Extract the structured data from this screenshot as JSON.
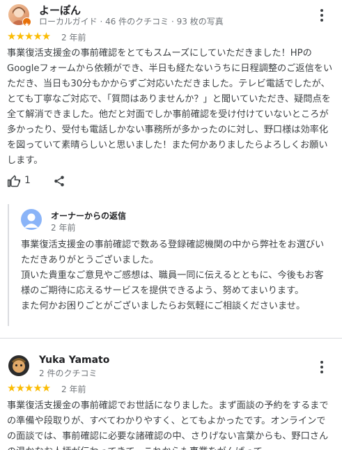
{
  "reviews": [
    {
      "author": "よーぽん",
      "meta": "ローカルガイド · 46 件のクチコミ · 93 枚の写真",
      "stars": "★★★★★",
      "rating": 5,
      "date": "2 年前",
      "text": "事業復活支援金の事前確認をとてもスムーズにしていただきました！HPのGoogleフォームから依頼ができ、半日も経たないうちに日程調整のご返信をいただき、当日も30分もかからずご対応いただきました。テレビ電話でしたが、とても丁寧なご対応で、「質問はありませんか？」と聞いていただき、疑問点を全て解消できました。他だと対面でしか事前確認を受け付けていないところが多かったり、受付も電話しかない事務所が多かったのに対し、野口様は効率化を図っていて素晴らしいと思いました！また何かありましたらよろしくお願いします。",
      "like_count": "1",
      "owner_reply": {
        "label": "オーナーからの返信",
        "date": "2 年前",
        "text": "事業復活支援金の事前確認で数ある登録確認機関の中から弊社をお選びいただきありがとうございました。\n頂いた貴重なご意見やご感想は、職員一同に伝えるとともに、今後もお客様のご期待に応えるサービスを提供できるよう、努めてまいります。\nまた何かお困りごとがございましたらお気軽にご相談くださいませ。"
      }
    },
    {
      "author": "Yuka Yamato",
      "meta": "2 件のクチコミ",
      "stars": "★★★★★",
      "rating": 5,
      "date": "2 年前",
      "text": "事業復活支援金の事前確認でお世話になりました。まず面談の予約をするまでの準備や段取りが、すべてわかりやすく、とてもよかったです。オンラインでの面談では、事前確認に必要な諸確認の中、さりげない言葉からも、野口さんの温かなお人柄が伝わってきて、これからも事業をがんばって"
    }
  ],
  "colors": {
    "star": "#fbbc04",
    "text": "#3c4043",
    "secondary": "#70757a"
  },
  "icons": [
    "more-vert-icon",
    "thumb-up-icon",
    "share-icon",
    "owner-avatar-icon",
    "local-guide-badge-icon"
  ]
}
